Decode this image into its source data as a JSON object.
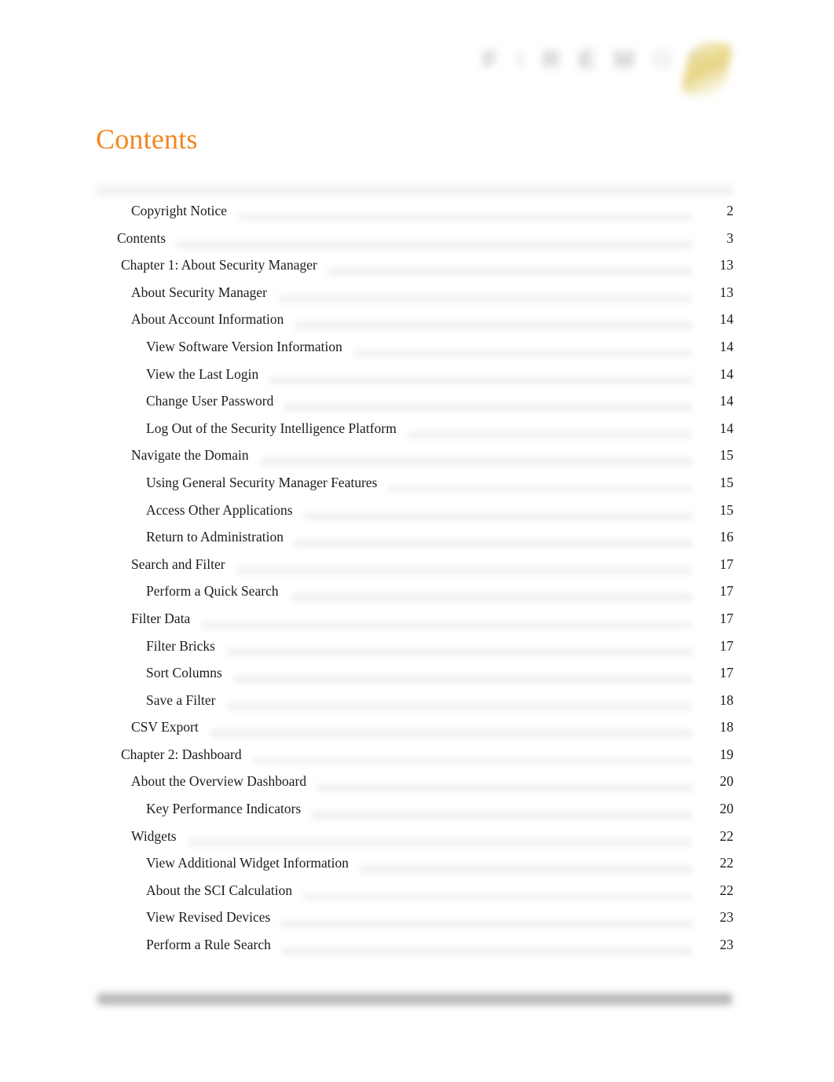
{
  "document": {
    "title": "Contents",
    "brand": {
      "name": "FIREMON",
      "letters": [
        "F",
        "I",
        "R",
        "E",
        "M",
        "O",
        "N"
      ],
      "flame_color": "#E5D37C",
      "wordmark_color": "#9A9A9A"
    },
    "accent_color": "#F08722",
    "text_color": "#1C1C1C",
    "footer": {
      "redacted": true,
      "color": "#B9B9B9"
    }
  },
  "toc": {
    "heading": "Contents",
    "entries": [
      {
        "label": "Copyright Notice",
        "page": "2",
        "level": 2
      },
      {
        "label": "Contents",
        "page": "3",
        "level": 0
      },
      {
        "label": "Chapter 1: About Security Manager",
        "page": "13",
        "level": 1
      },
      {
        "label": "About Security Manager",
        "page": "13",
        "level": 2
      },
      {
        "label": "About Account Information",
        "page": "14",
        "level": 2
      },
      {
        "label": "View Software Version Information",
        "page": "14",
        "level": 3
      },
      {
        "label": "View the Last Login",
        "page": "14",
        "level": 3
      },
      {
        "label": "Change User Password",
        "page": "14",
        "level": 3
      },
      {
        "label": "Log Out of the Security Intelligence Platform",
        "page": "14",
        "level": 3
      },
      {
        "label": "Navigate the Domain",
        "page": "15",
        "level": 2
      },
      {
        "label": "Using General Security Manager Features",
        "page": "15",
        "level": 3
      },
      {
        "label": "Access Other Applications",
        "page": "15",
        "level": 3
      },
      {
        "label": "Return to Administration",
        "page": "16",
        "level": 3
      },
      {
        "label": "Search and Filter",
        "page": "17",
        "level": 2
      },
      {
        "label": "Perform a Quick Search",
        "page": "17",
        "level": 3
      },
      {
        "label": "Filter Data",
        "page": "17",
        "level": 2
      },
      {
        "label": "Filter Bricks",
        "page": "17",
        "level": 3
      },
      {
        "label": "Sort Columns",
        "page": "17",
        "level": 3
      },
      {
        "label": "Save a Filter",
        "page": "18",
        "level": 3
      },
      {
        "label": "CSV Export",
        "page": "18",
        "level": 2
      },
      {
        "label": "Chapter 2: Dashboard",
        "page": "19",
        "level": 1
      },
      {
        "label": "About the Overview Dashboard",
        "page": "20",
        "level": 2
      },
      {
        "label": "Key Performance Indicators",
        "page": "20",
        "level": 3
      },
      {
        "label": "Widgets",
        "page": "22",
        "level": 2
      },
      {
        "label": "View Additional Widget Information",
        "page": "22",
        "level": 3
      },
      {
        "label": "About the SCI Calculation",
        "page": "22",
        "level": 3
      },
      {
        "label": "View Revised Devices",
        "page": "23",
        "level": 3
      },
      {
        "label": "Perform a Rule Search",
        "page": "23",
        "level": 3
      }
    ]
  }
}
